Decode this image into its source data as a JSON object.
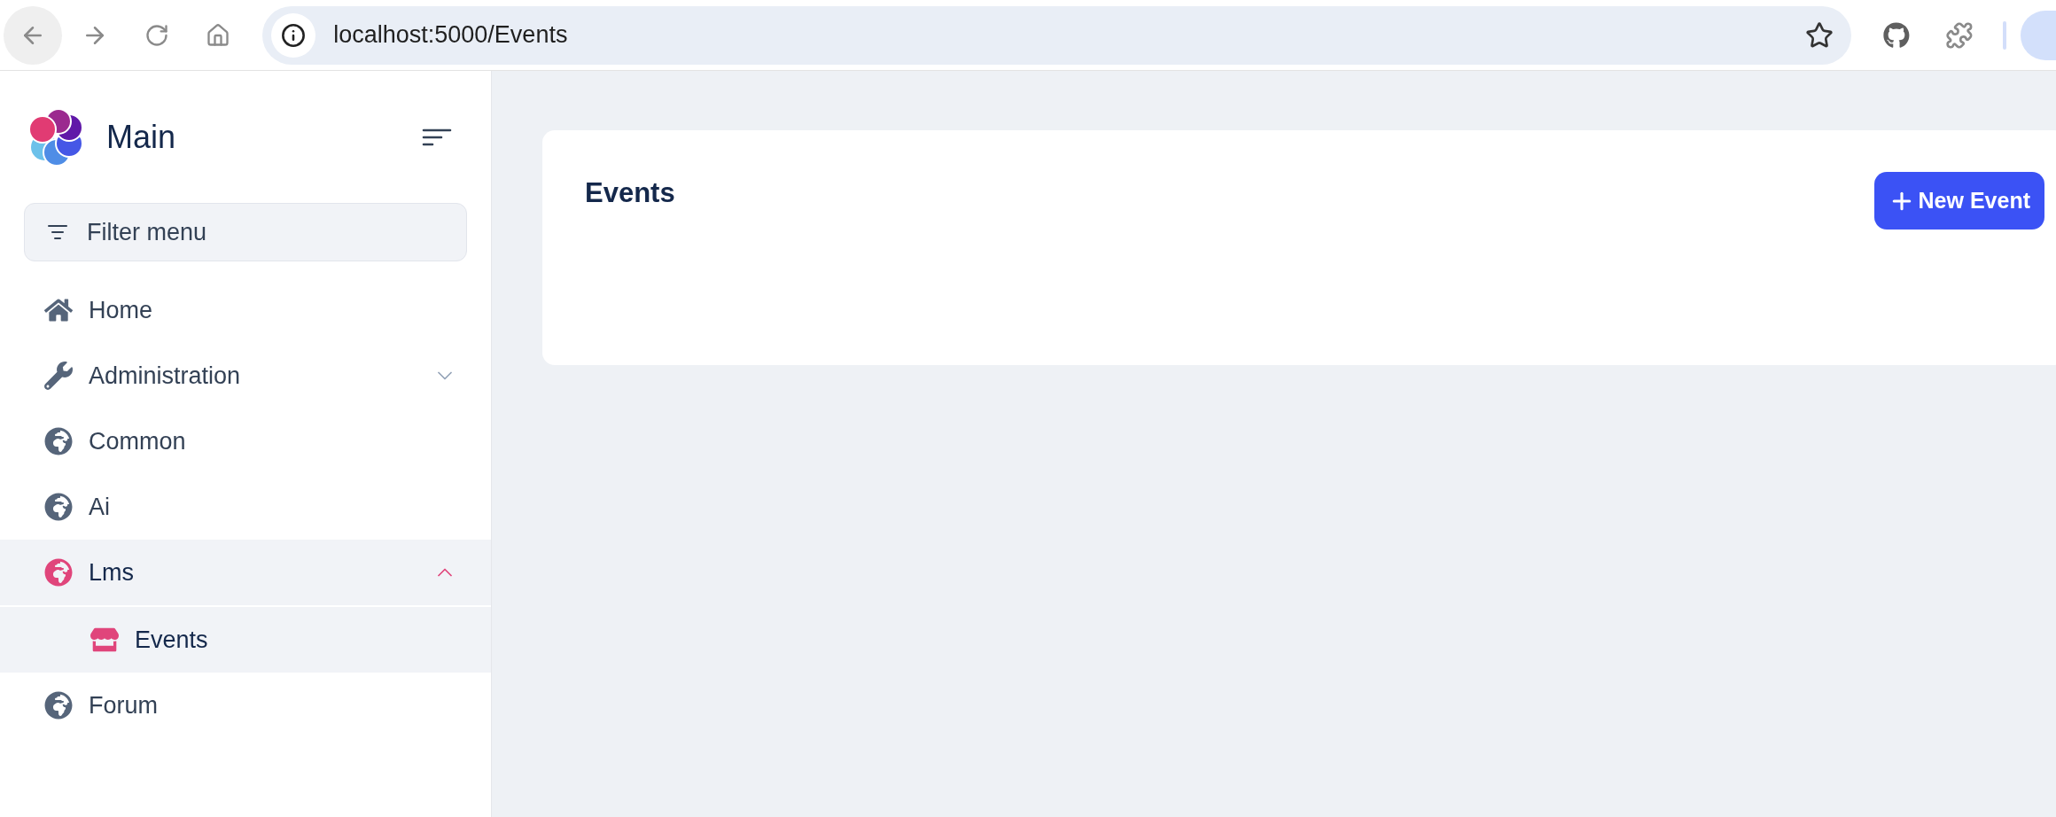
{
  "browser": {
    "url": "localhost:5000/Events"
  },
  "sidebar": {
    "title": "Main",
    "filter": {
      "placeholder": "Filter menu"
    },
    "items": [
      {
        "label": "Home",
        "kind": "home",
        "selected": false
      },
      {
        "label": "Administration",
        "kind": "tools",
        "selected": false,
        "expanded": false
      },
      {
        "label": "Common",
        "kind": "module",
        "selected": false
      },
      {
        "label": "Ai",
        "kind": "module",
        "selected": false
      },
      {
        "label": "Lms",
        "kind": "module",
        "selected": true,
        "expanded": true,
        "children": [
          {
            "label": "Events",
            "kind": "page",
            "selected": true
          }
        ]
      },
      {
        "label": "Forum",
        "kind": "module",
        "selected": false
      }
    ]
  },
  "page": {
    "title": "Events",
    "button": "New Event"
  }
}
